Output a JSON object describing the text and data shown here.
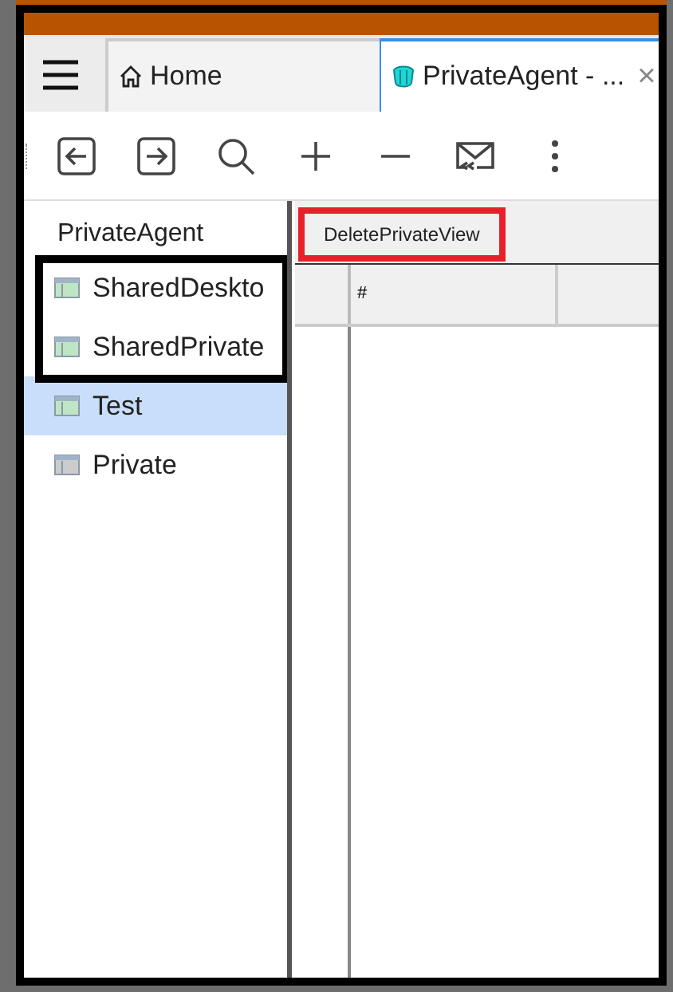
{
  "tabs": [
    {
      "kind": "home",
      "label": "Home",
      "selected": false
    },
    {
      "kind": "agent",
      "label": "PrivateAgent - ...",
      "selected": true,
      "close": "×"
    }
  ],
  "toolbar": [
    {
      "kind": "back"
    },
    {
      "kind": "forward"
    },
    {
      "kind": "search"
    },
    {
      "kind": "add"
    },
    {
      "kind": "remove"
    },
    {
      "kind": "mail"
    },
    {
      "kind": "more"
    }
  ],
  "sidebar": {
    "title": "PrivateAgent",
    "items": [
      {
        "label": "SharedDeskto",
        "selected": false,
        "disabled": false
      },
      {
        "label": "SharedPrivate",
        "selected": false,
        "disabled": false
      },
      {
        "label": "Test",
        "selected": true,
        "disabled": false
      },
      {
        "label": "Private",
        "selected": false,
        "disabled": true
      }
    ]
  },
  "view_tab": {
    "label": "DeletePrivateView"
  },
  "grid": {
    "columns": [
      "#"
    ]
  }
}
